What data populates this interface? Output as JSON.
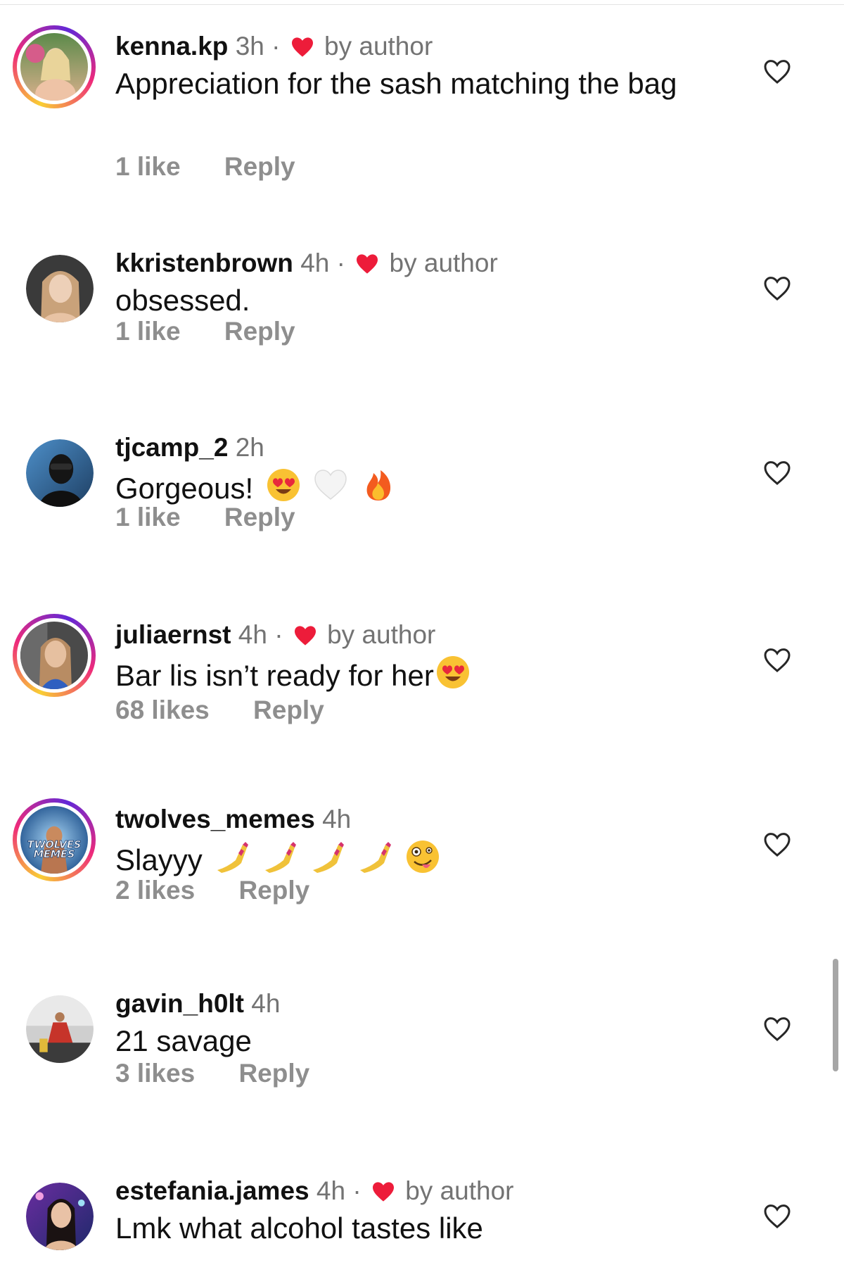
{
  "comments": [
    {
      "username": "kenna.kp",
      "time": "3h",
      "separator": "·",
      "by_author": "by author",
      "text": "Appreciation for the sash matching the bag",
      "likes": "1 like",
      "reply": "Reply"
    },
    {
      "username": "kkristenbrown",
      "time": "4h",
      "separator": "·",
      "by_author": "by author",
      "text": "obsessed.",
      "likes": "1 like",
      "reply": "Reply"
    },
    {
      "username": "tjcamp_2",
      "time": "2h",
      "text": "Gorgeous!",
      "emojis": [
        "heart-eyes-emoji",
        "white-heart-emoji",
        "fire-emoji"
      ],
      "likes": "1 like",
      "reply": "Reply"
    },
    {
      "username": "juliaernst",
      "time": "4h",
      "separator": "·",
      "by_author": "by author",
      "text": "Bar lis isn’t ready for her",
      "emojis": [
        "heart-eyes-emoji"
      ],
      "likes": "68 likes",
      "reply": "Reply"
    },
    {
      "username": "twolves_memes",
      "time": "4h",
      "text": "Slayyy",
      "emojis": [
        "nail-polish-emoji",
        "nail-polish-emoji",
        "nail-polish-emoji",
        "nail-polish-emoji",
        "zany-face-emoji"
      ],
      "avatar_text": "TWOLVES MEMES",
      "likes": "2 likes",
      "reply": "Reply"
    },
    {
      "username": "gavin_h0lt",
      "time": "4h",
      "text": "21 savage",
      "likes": "3 likes",
      "reply": "Reply"
    },
    {
      "username": "estefania.james",
      "time": "4h",
      "separator": "·",
      "by_author": "by author",
      "text": "Lmk what alcohol tastes like"
    }
  ],
  "colors": {
    "text": "#111111",
    "secondary": "#737373",
    "action": "#8e8e8e",
    "author_heart": "#ed1c3a",
    "story_ring": [
      "#f9ce34",
      "#ee2a7b",
      "#6228d7"
    ]
  },
  "icons": {
    "like": "heart-outline-icon",
    "author_like": "heart-filled-icon"
  }
}
